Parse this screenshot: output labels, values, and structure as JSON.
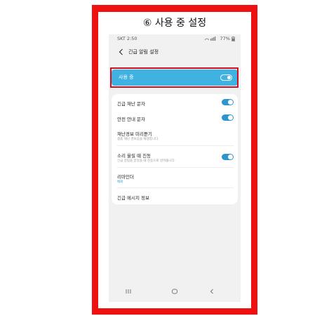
{
  "step_title": "⑥ 사용 중 설정",
  "status_bar": {
    "carrier_time": "SKT 2:50",
    "battery": "77%"
  },
  "header": {
    "title": "긴급 알림 설정"
  },
  "master_toggle": {
    "label": "사용 중",
    "state": "on"
  },
  "settings": [
    {
      "title": "긴급 재난 문자",
      "subtitle": "",
      "toggle": "on"
    },
    {
      "title": "안전 안내 문자",
      "subtitle": "",
      "toggle": "on"
    },
    {
      "title": "재난경보 미리듣기",
      "subtitle": "샘플 재난 경보음을 재생합니다."
    },
    {
      "title": "소리 울릴 때 진동",
      "subtitle": "긴급 알림을 받았을 때 진동으로 알려줍니다.",
      "toggle": "on"
    },
    {
      "title": "리마인더",
      "subtitle": "매회"
    },
    {
      "title": "긴급 메시지 정보",
      "subtitle": ""
    }
  ],
  "colors": {
    "frame_red": "#ee1111",
    "highlight_red": "#d0101e",
    "accent_blue": "#3fb2e2",
    "toggle_blue": "#2e95cf"
  },
  "icons": [
    "back-arrow-icon",
    "recent-apps-icon",
    "home-icon",
    "back-nav-icon"
  ]
}
